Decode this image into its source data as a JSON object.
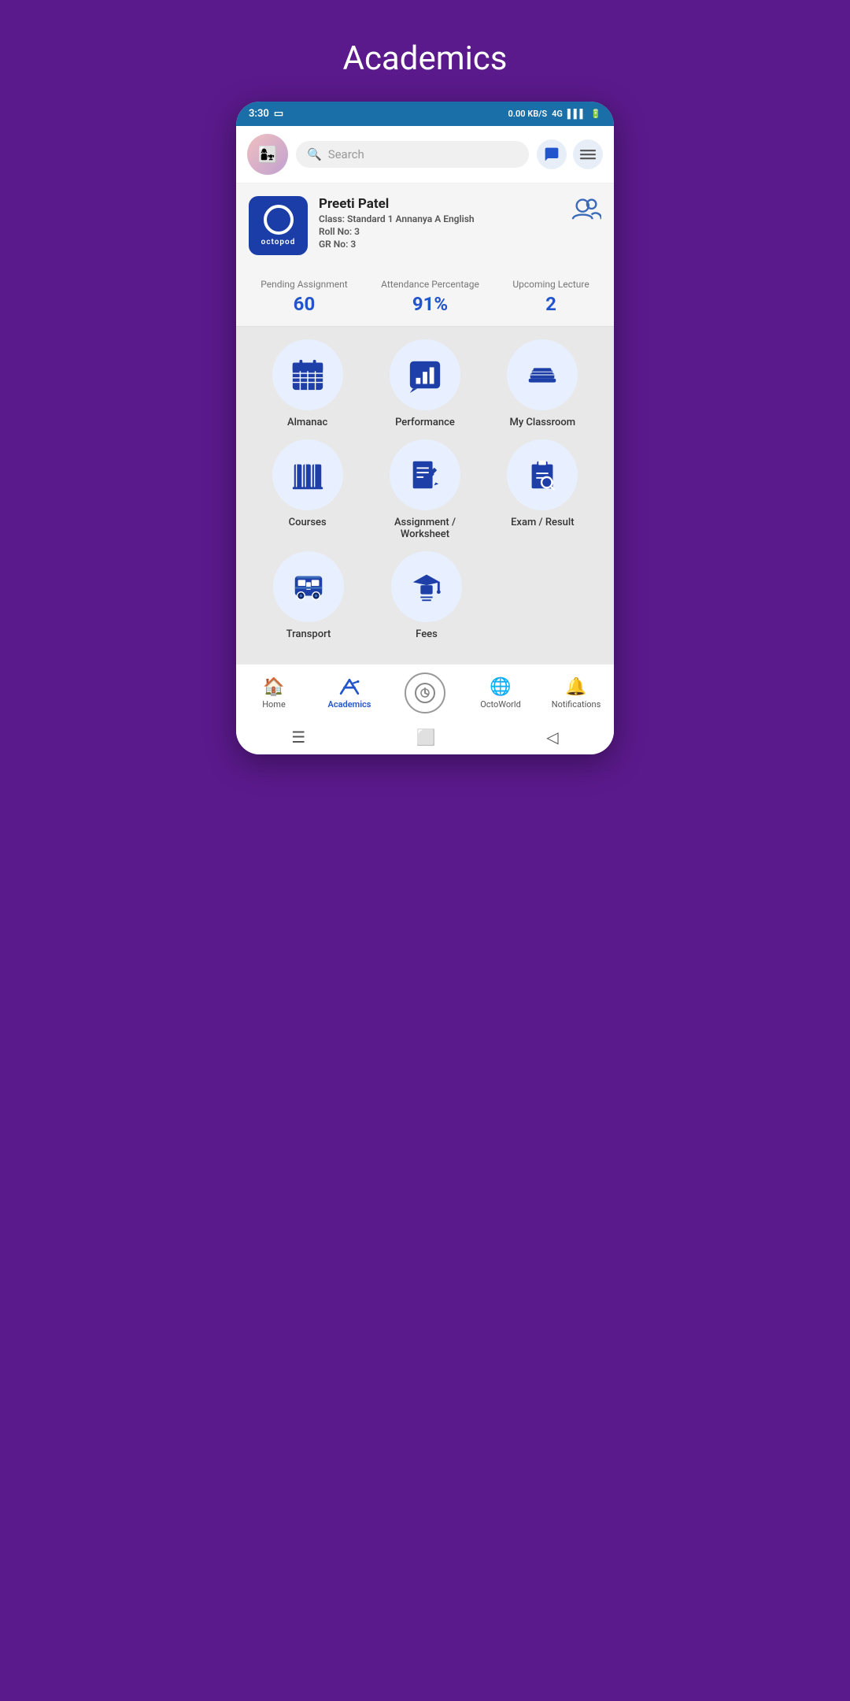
{
  "page": {
    "title": "Academics",
    "background_color": "#5b1a8c"
  },
  "status_bar": {
    "time": "3:30",
    "network": "4G",
    "battery": "6"
  },
  "header": {
    "search_placeholder": "Search",
    "avatar_emoji": "👩‍👧"
  },
  "profile": {
    "name": "Preeti Patel",
    "class_label": "Class:",
    "class_value": "Standard 1 Annanya A English",
    "roll_label": "Roll No:",
    "roll_value": "3",
    "gr_label": "GR No:",
    "gr_value": "3",
    "logo_text": "octopod"
  },
  "stats": [
    {
      "label": "Pending Assignment",
      "value": "60"
    },
    {
      "label": "Attendance Percentage",
      "value": "91%"
    },
    {
      "label": "Upcoming Lecture",
      "value": "2"
    }
  ],
  "grid": [
    [
      {
        "id": "almanac",
        "label": "Almanac",
        "icon": "calendar"
      },
      {
        "id": "performance",
        "label": "Performance",
        "icon": "chart"
      },
      {
        "id": "my-classroom",
        "label": "My Classroom",
        "icon": "books-stack"
      }
    ],
    [
      {
        "id": "courses",
        "label": "Courses",
        "icon": "books"
      },
      {
        "id": "assignment-worksheet",
        "label": "Assignment / Worksheet",
        "icon": "assignment"
      },
      {
        "id": "exam-result",
        "label": "Exam / Result",
        "icon": "exam"
      }
    ],
    [
      {
        "id": "transport",
        "label": "Transport",
        "icon": "bus"
      },
      {
        "id": "fees",
        "label": "Fees",
        "icon": "graduation"
      }
    ]
  ],
  "bottom_nav": [
    {
      "id": "home",
      "label": "Home",
      "icon": "🏠",
      "active": false
    },
    {
      "id": "academics",
      "label": "Academics",
      "icon": "✏️",
      "active": true
    },
    {
      "id": "octoworld",
      "label": "OctoWorld",
      "icon": "🌐",
      "active": false
    },
    {
      "id": "notifications",
      "label": "Notifications",
      "icon": "🔔",
      "active": false
    }
  ]
}
